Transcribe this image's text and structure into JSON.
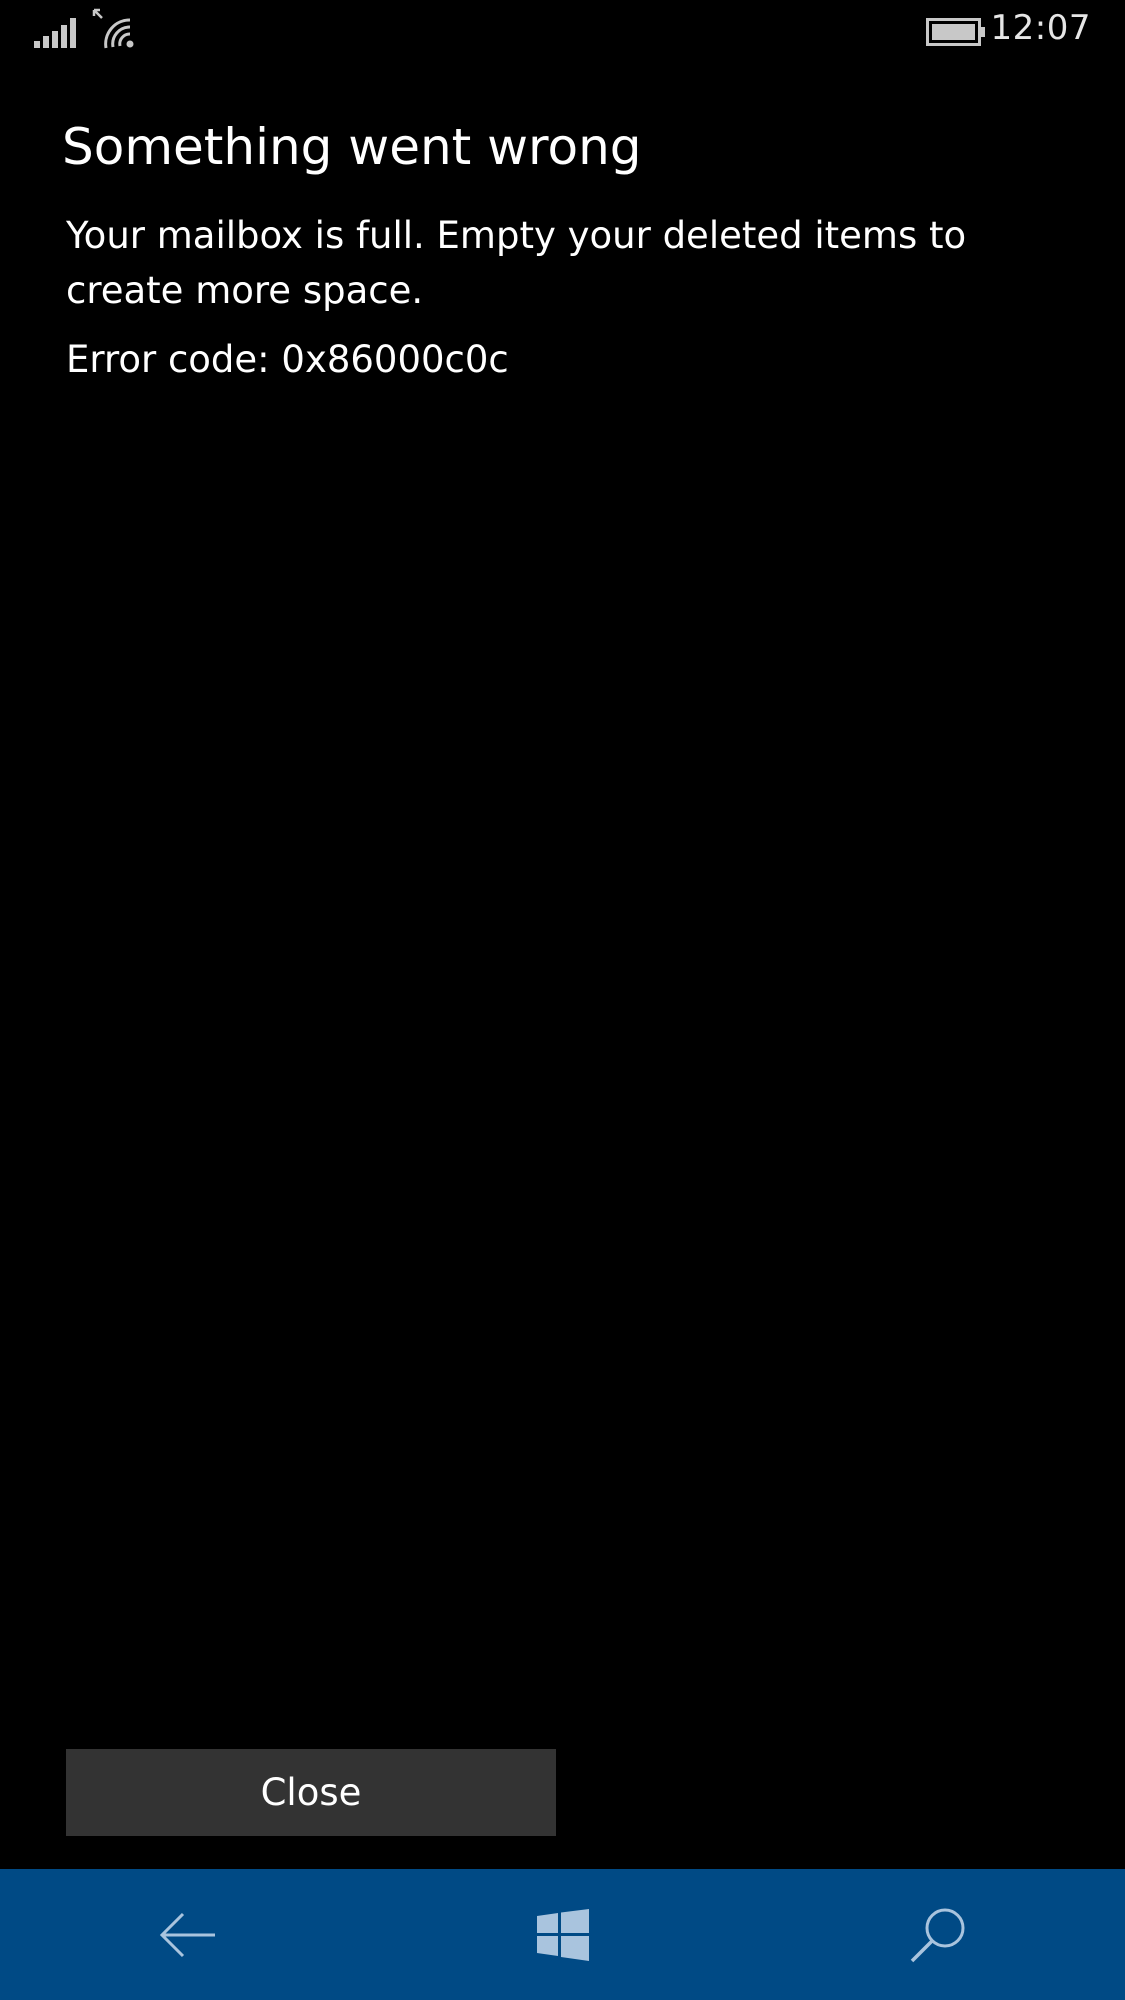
{
  "status_bar": {
    "time": "12:07",
    "icons": [
      "signal-strength-icon",
      "wifi-icon",
      "battery-icon"
    ]
  },
  "dialog": {
    "title": "Something went wrong",
    "message": "Your mailbox is full. Empty your deleted items to create more space.",
    "error_code": "Error code: 0x86000c0c",
    "close_label": "Close"
  },
  "nav_bar": {
    "items": [
      "back-arrow-icon",
      "windows-start-icon",
      "search-icon"
    ]
  },
  "colors": {
    "background": "#000000",
    "text": "#ffffff",
    "button": "#333333",
    "nav_bar": "#004a85",
    "status_icons": "#c8c8c8"
  }
}
